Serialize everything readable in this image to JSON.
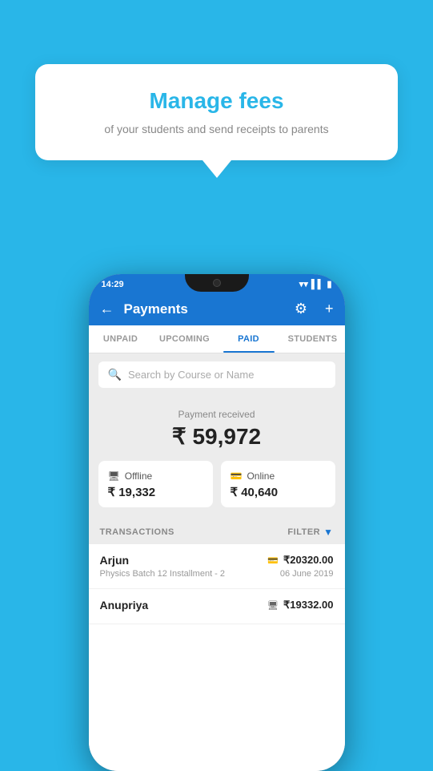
{
  "background_color": "#29b6e8",
  "callout": {
    "title": "Manage fees",
    "subtitle": "of your students and send receipts to parents"
  },
  "status_bar": {
    "time": "14:29",
    "wifi_icon": "wifi",
    "signal_icon": "signal",
    "battery_icon": "battery"
  },
  "header": {
    "title": "Payments",
    "back_label": "←",
    "settings_label": "⚙",
    "add_label": "+"
  },
  "tabs": [
    {
      "label": "UNPAID",
      "active": false
    },
    {
      "label": "UPCOMING",
      "active": false
    },
    {
      "label": "PAID",
      "active": true
    },
    {
      "label": "STUDENTS",
      "active": false
    }
  ],
  "search": {
    "placeholder": "Search by Course or Name"
  },
  "payment_summary": {
    "label": "Payment received",
    "amount": "₹ 59,972"
  },
  "payment_cards": [
    {
      "icon": "🖥",
      "label": "Offline",
      "amount": "₹ 19,332"
    },
    {
      "icon": "💳",
      "label": "Online",
      "amount": "₹ 40,640"
    }
  ],
  "transactions_section": {
    "label": "TRANSACTIONS",
    "filter_label": "FILTER"
  },
  "transactions": [
    {
      "name": "Arjun",
      "detail": "Physics Batch 12 Installment - 2",
      "amount": "₹20320.00",
      "date": "06 June 2019",
      "type_icon": "💳"
    },
    {
      "name": "Anupriya",
      "detail": "",
      "amount": "₹19332.00",
      "date": "",
      "type_icon": "🖥"
    }
  ]
}
